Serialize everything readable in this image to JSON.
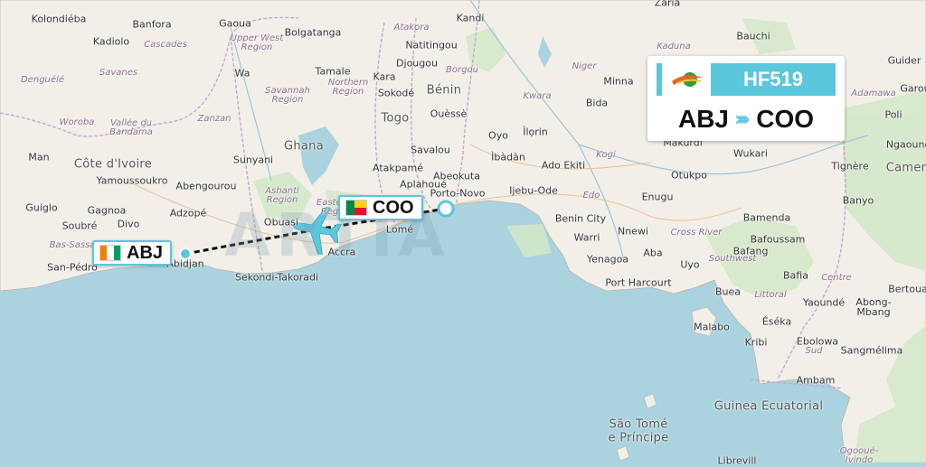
{
  "flight": {
    "number": "HF519",
    "origin": "ABJ",
    "destination": "COO",
    "arrows": "››››",
    "origin_flag_colors": [
      "#f77f00",
      "#ffffff",
      "#009e60"
    ],
    "destination_flag_colors": [
      "#008751",
      "#fcd116",
      "#e8112d"
    ],
    "accent_color": "#5bc7dc"
  },
  "watermark": "ARTIA",
  "map_labels": {
    "countries": [
      {
        "id": "cote-divoire",
        "text": "Côte d'Ivoire"
      },
      {
        "id": "ghana",
        "text": "Ghana"
      },
      {
        "id": "togo",
        "text": "Togo"
      },
      {
        "id": "benin",
        "text": "Bénin"
      },
      {
        "id": "cameroon",
        "text": "Camero"
      },
      {
        "id": "guinea-ecuatorial",
        "text": "Guinea Ecuatorial"
      },
      {
        "id": "sao-tome",
        "text": "São Tomé"
      },
      {
        "id": "principe",
        "text": "e Príncipe"
      }
    ],
    "cities": [
      {
        "id": "kolondieba",
        "text": "Kolondiéba"
      },
      {
        "id": "kadiolo",
        "text": "Kadiolo"
      },
      {
        "id": "banfora",
        "text": "Banfora"
      },
      {
        "id": "gaoua",
        "text": "Gaoua"
      },
      {
        "id": "bolgatanga",
        "text": "Bolgatanga"
      },
      {
        "id": "natitingou",
        "text": "Natitingou"
      },
      {
        "id": "kandi",
        "text": "Kandi"
      },
      {
        "id": "djougou",
        "text": "Djougou"
      },
      {
        "id": "kara",
        "text": "Kara"
      },
      {
        "id": "sokode",
        "text": "Sokodé"
      },
      {
        "id": "wa",
        "text": "Wa"
      },
      {
        "id": "tamale",
        "text": "Tamale"
      },
      {
        "id": "sunyani",
        "text": "Sunyani"
      },
      {
        "id": "man",
        "text": "Man"
      },
      {
        "id": "yamoussoukro",
        "text": "Yamoussoukro"
      },
      {
        "id": "abengourou",
        "text": "Abengourou"
      },
      {
        "id": "gagnoa",
        "text": "Gagnoa"
      },
      {
        "id": "guiglo",
        "text": "Guiglo"
      },
      {
        "id": "soubre",
        "text": "Soubré"
      },
      {
        "id": "divo",
        "text": "Divo"
      },
      {
        "id": "adzope",
        "text": "Adzopé"
      },
      {
        "id": "san-pedro",
        "text": "San-Pédro"
      },
      {
        "id": "abidjan",
        "text": "Abidjan"
      },
      {
        "id": "obuasi",
        "text": "Obuasi"
      },
      {
        "id": "accra",
        "text": "Accra"
      },
      {
        "id": "sekondi",
        "text": "Sekondi-Takoradi"
      },
      {
        "id": "lome",
        "text": "Lomé"
      },
      {
        "id": "atakpame",
        "text": "Atakpamé"
      },
      {
        "id": "aplahoue",
        "text": "Aplahoué"
      },
      {
        "id": "savalou",
        "text": "Savalou"
      },
      {
        "id": "ouesse",
        "text": "Ouèssè"
      },
      {
        "id": "abeokuta",
        "text": "Abeokuta"
      },
      {
        "id": "porto-novo",
        "text": "Porto-Novo"
      },
      {
        "id": "ijebu-ode",
        "text": "Ijebu-Ode"
      },
      {
        "id": "ilorin",
        "text": "Ìlọrin"
      },
      {
        "id": "ibadan",
        "text": "Ìbàdàn"
      },
      {
        "id": "ado-ekiti",
        "text": "Ado Ekiti"
      },
      {
        "id": "oyo",
        "text": "Oyo"
      },
      {
        "id": "benin-city",
        "text": "Benin City"
      },
      {
        "id": "warri",
        "text": "Warri"
      },
      {
        "id": "yenagoa",
        "text": "Yenagoa"
      },
      {
        "id": "port-harcourt",
        "text": "Port Harcourt"
      },
      {
        "id": "aba",
        "text": "Aba"
      },
      {
        "id": "uyo",
        "text": "Uyo"
      },
      {
        "id": "nnewi",
        "text": "Nnewi"
      },
      {
        "id": "enugu",
        "text": "Enugu"
      },
      {
        "id": "otukpo",
        "text": "Otukpo"
      },
      {
        "id": "makurdi",
        "text": "Makurdi"
      },
      {
        "id": "wukari",
        "text": "Wukari"
      },
      {
        "id": "minna",
        "text": "Minna"
      },
      {
        "id": "bida",
        "text": "Bida"
      },
      {
        "id": "zaria",
        "text": "Zaria"
      },
      {
        "id": "bauchi",
        "text": "Bauchi"
      },
      {
        "id": "guider",
        "text": "Guider"
      },
      {
        "id": "garoua",
        "text": "Garou"
      },
      {
        "id": "poli",
        "text": "Poli"
      },
      {
        "id": "ngaoundere",
        "text": "Ngaoundé"
      },
      {
        "id": "tignere",
        "text": "Tignère"
      },
      {
        "id": "banyo",
        "text": "Banyo"
      },
      {
        "id": "bamenda",
        "text": "Bamenda"
      },
      {
        "id": "bafoussam",
        "text": "Bafoussam"
      },
      {
        "id": "bafang",
        "text": "Bafang"
      },
      {
        "id": "bafia",
        "text": "Bafia"
      },
      {
        "id": "bertoua",
        "text": "Bertoua"
      },
      {
        "id": "buea",
        "text": "Buea"
      },
      {
        "id": "malabo",
        "text": "Malabo"
      },
      {
        "id": "yaounde",
        "text": "Yaoundé"
      },
      {
        "id": "abong-mbang",
        "text": "Abong-\nMbang"
      },
      {
        "id": "eseka",
        "text": "Éséka"
      },
      {
        "id": "ebolowa",
        "text": "Ebolowa"
      },
      {
        "id": "kribi",
        "text": "Kribi"
      },
      {
        "id": "sangmelima",
        "text": "Sangmélima"
      },
      {
        "id": "ambam",
        "text": "Ambam"
      },
      {
        "id": "libreville",
        "text": "Librevill"
      }
    ],
    "regions": [
      {
        "id": "upper-west",
        "text": "Upper West\nRegion"
      },
      {
        "id": "cascades",
        "text": "Cascades"
      },
      {
        "id": "savanes",
        "text": "Savanes"
      },
      {
        "id": "denguele",
        "text": "Denguélé"
      },
      {
        "id": "woroba",
        "text": "Woroba"
      },
      {
        "id": "bandama",
        "text": "Vallée du\nBandama"
      },
      {
        "id": "zanzan",
        "text": "Zanzan"
      },
      {
        "id": "savannah",
        "text": "Savannah\nRegion"
      },
      {
        "id": "northern",
        "text": "Northern\nRegion"
      },
      {
        "id": "atakora",
        "text": "Atakora"
      },
      {
        "id": "borgou",
        "text": "Borgou"
      },
      {
        "id": "ashanti",
        "text": "Ashanti\nRegion"
      },
      {
        "id": "eastern",
        "text": "Eastern\nRegio"
      },
      {
        "id": "bas-sassandra",
        "text": "Bas-Sassa"
      },
      {
        "id": "niger",
        "text": "Niger"
      },
      {
        "id": "kaduna",
        "text": "Kaduna"
      },
      {
        "id": "kwara",
        "text": "Kwara"
      },
      {
        "id": "kogi",
        "text": "Kogi"
      },
      {
        "id": "edo",
        "text": "Edo"
      },
      {
        "id": "cross-river",
        "text": "Cross River"
      },
      {
        "id": "southwest",
        "text": "Southwest"
      },
      {
        "id": "littoral",
        "text": "Littoral"
      },
      {
        "id": "centre",
        "text": "Centre"
      },
      {
        "id": "sud",
        "text": "Sud"
      },
      {
        "id": "adamawa",
        "text": "Adamawa"
      },
      {
        "id": "ogooue",
        "text": "Ogooué-\nIvindo"
      }
    ]
  }
}
